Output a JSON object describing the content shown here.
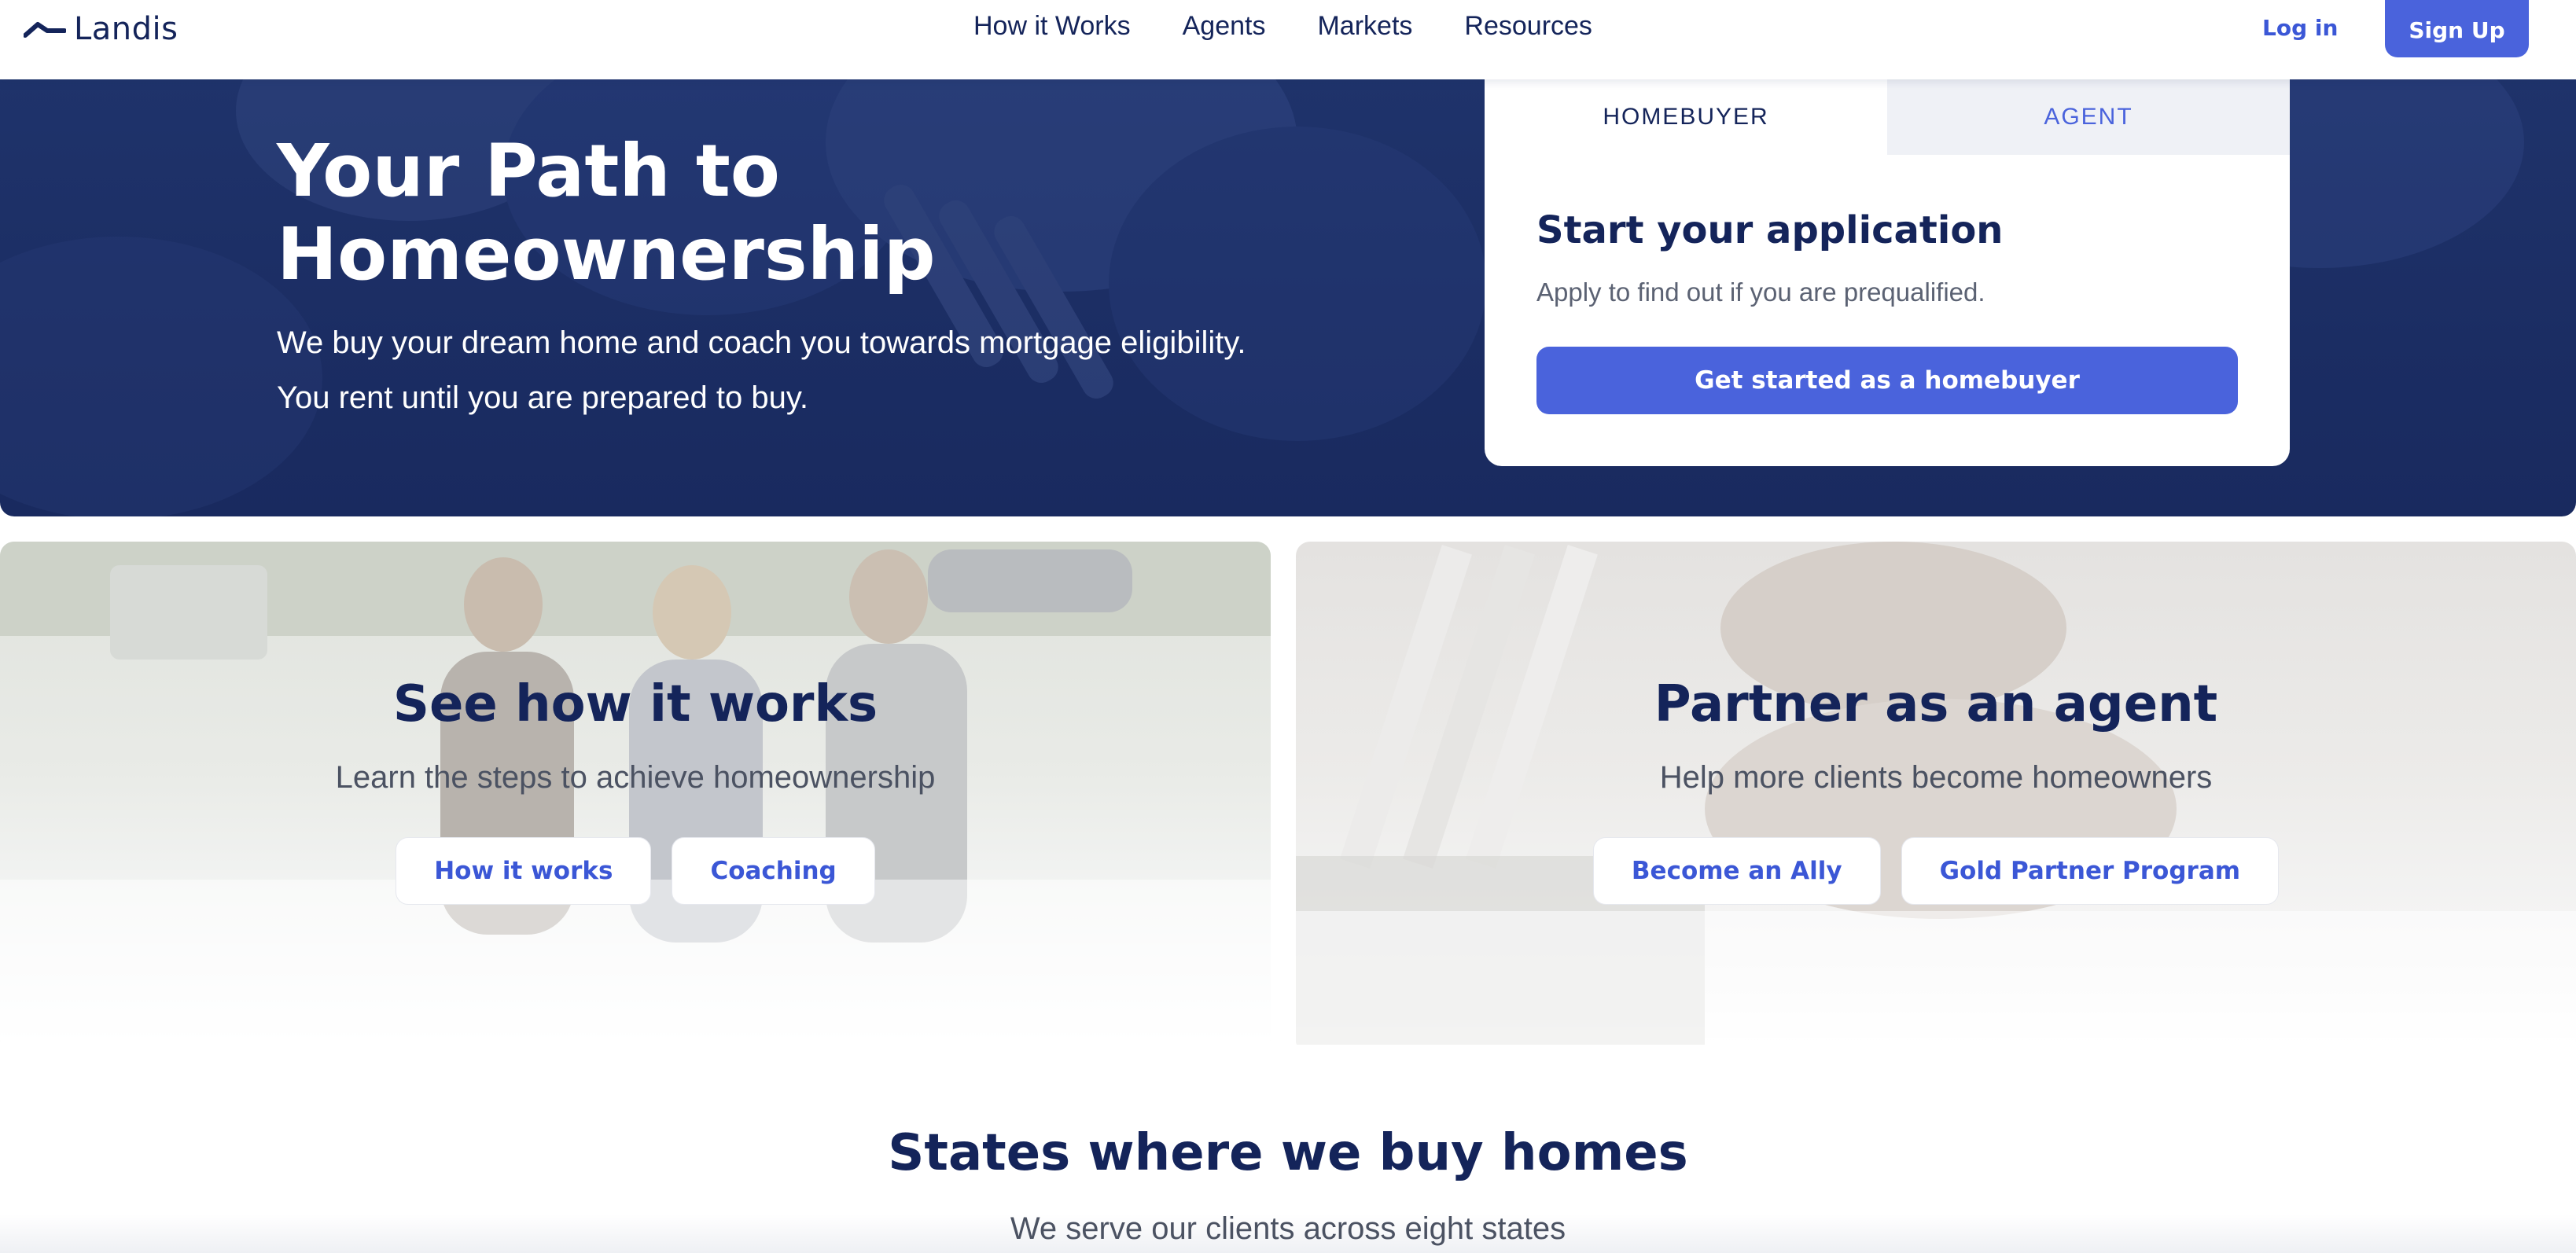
{
  "nav": {
    "brand": "Landis",
    "links": [
      "How it Works",
      "Agents",
      "Markets",
      "Resources"
    ],
    "login": "Log in",
    "signup": "Sign Up"
  },
  "hero": {
    "title": "Your Path to Homeownership",
    "subtitle_line1": "We buy your dream home and coach you towards mortgage eligibility.",
    "subtitle_line2": "You rent until you are prepared to buy."
  },
  "application_card": {
    "tabs": [
      "HOMEBUYER",
      "AGENT"
    ],
    "active_tab": "HOMEBUYER",
    "title": "Start your application",
    "text": "Apply to find out if you are prequalified.",
    "button": "Get started as a homebuyer"
  },
  "promos": [
    {
      "title": "See how it works",
      "subtitle": "Learn the steps to achieve homeownership",
      "buttons": [
        "How it works",
        "Coaching"
      ]
    },
    {
      "title": "Partner as an agent",
      "subtitle": "Help more clients become homeowners",
      "buttons": [
        "Become an Ally",
        "Gold Partner Program"
      ]
    }
  ],
  "states": {
    "title": "States where we buy homes",
    "subtitle": "We serve our clients across eight states"
  },
  "colors": {
    "navy": "#14245a",
    "accent": "#4a63dc",
    "hero_bg": "#1f336b"
  }
}
